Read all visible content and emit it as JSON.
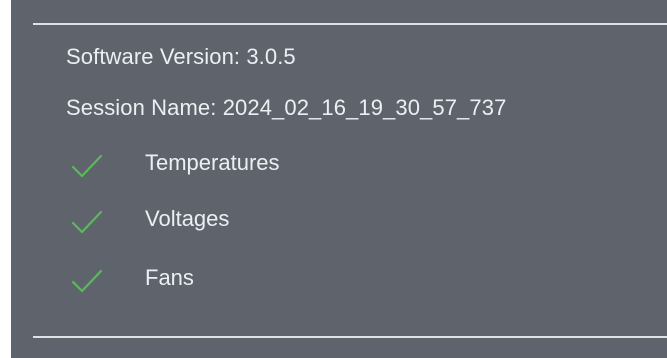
{
  "colors": {
    "panel_bg": "#5f646c",
    "text": "#eceff2",
    "rule": "#dfe1e4",
    "check": "#5cb85c"
  },
  "info": {
    "software_version": "Software Version: 3.0.5",
    "session_name": "Session Name: 2024_02_16_19_30_57_737"
  },
  "checklist": [
    {
      "label": "Temperatures",
      "status": "checked",
      "icon": "checkmark-icon"
    },
    {
      "label": "Voltages",
      "status": "checked",
      "icon": "checkmark-icon"
    },
    {
      "label": "Fans",
      "status": "checked",
      "icon": "checkmark-icon"
    }
  ]
}
